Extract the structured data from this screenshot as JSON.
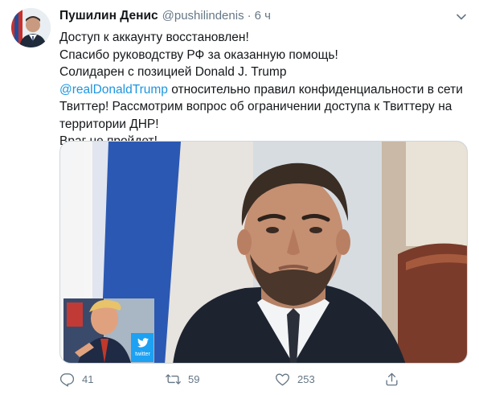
{
  "tweet": {
    "author_name": "Пушилин Денис",
    "handle": "@pushilindenis",
    "separator": "·",
    "time": "6 ч",
    "lines": [
      "Доступ к аккаунту восстановлен!",
      "Спасибо руководству РФ за оказанную помощь!",
      "Солидарен с позицией Donald J. Trump"
    ],
    "mention": "@realDonaldTrump",
    "line4_rest": " относительно правил конфиденциальности в сети",
    "lines_tail": [
      "Твиттер! Рассмотрим вопрос об ограничении доступа к Твиттеру на",
      "территории ДНР!",
      "Враг не пройдет!"
    ],
    "inset_label": "twitter"
  },
  "actions": {
    "reply_count": "41",
    "retweet_count": "59",
    "like_count": "253"
  },
  "icons": {
    "reply": "reply-icon",
    "retweet": "retweet-icon",
    "like": "heart-icon",
    "share": "share-icon",
    "more": "chevron-down-icon"
  },
  "colors": {
    "link": "#1b95e0",
    "secondary_text": "#657786",
    "primary_text": "#14171a"
  }
}
